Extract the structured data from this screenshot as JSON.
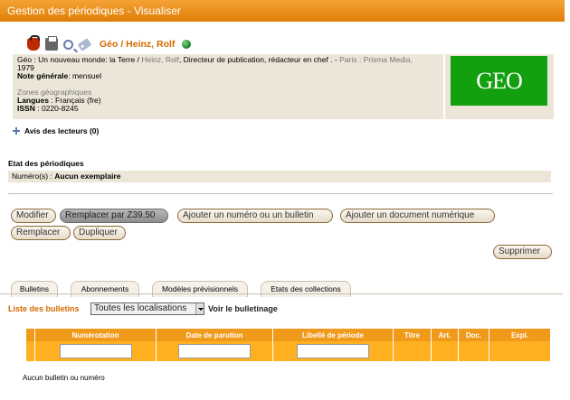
{
  "window": {
    "title": "Gestion des périodiques - Visualiser"
  },
  "record": {
    "title": "Géo / Heinz, Rolf",
    "desc_lead": "Géo : Un nouveau monde: la Terre /",
    "desc_author": "Heinz, Rolf",
    "desc_role": ", Directeur de publication, rédacteur en chef .",
    "desc_pub_sep": " - ",
    "desc_publisher": "Paris : Prisma Media,",
    "year": "1979",
    "note_label": "Note générale",
    "note_value": "mensuel",
    "zones_label": "Zones géographiques",
    "langues_label": "Langues",
    "langues_value": "Français (fre)",
    "issn_label": "ISSN",
    "issn_value": "0220-8245",
    "logo_text": "GEO"
  },
  "avis": {
    "label": "Avis des lecteurs (0)"
  },
  "etat": {
    "title": "Etat des périodiques",
    "numero_label": "Numéro(s) :",
    "numero_value": "Aucun exemplaire"
  },
  "actions": {
    "modifier": "Modifier",
    "remplacer_z3950": "Remplacer par Z39.50",
    "ajouter_numero": "Ajouter un numéro ou un bulletin",
    "ajouter_document": "Ajouter un document numérique",
    "remplacer": "Remplacer",
    "dupliquer": "Dupliquer",
    "supprimer": "Supprimer"
  },
  "tabs": [
    {
      "label": "Bulletins"
    },
    {
      "label": "Abonnements"
    },
    {
      "label": "Modèles prévisionnels"
    },
    {
      "label": "Etats des collections"
    }
  ],
  "bulletins": {
    "label": "Liste des bulletins",
    "location_select": "Toutes les localisations",
    "voir_link": "Voir le bulletinage",
    "columns": [
      "Numérotation",
      "Date de parution",
      "Libellé de période",
      "Titre",
      "Art.",
      "Doc.",
      "Expl."
    ],
    "empty_message": "Aucun bulletin ou numéro"
  },
  "colors": {
    "accent": "#e58a0f",
    "header_row": "#f09a1c",
    "filter_row": "#ffb020",
    "panel": "#ece6d8",
    "link": "#d46a00"
  },
  "icons": [
    "basket-icon",
    "printer-icon",
    "search-icon",
    "tag-icon",
    "globe-icon",
    "plus-icon",
    "dropdown-arrow-icon"
  ]
}
